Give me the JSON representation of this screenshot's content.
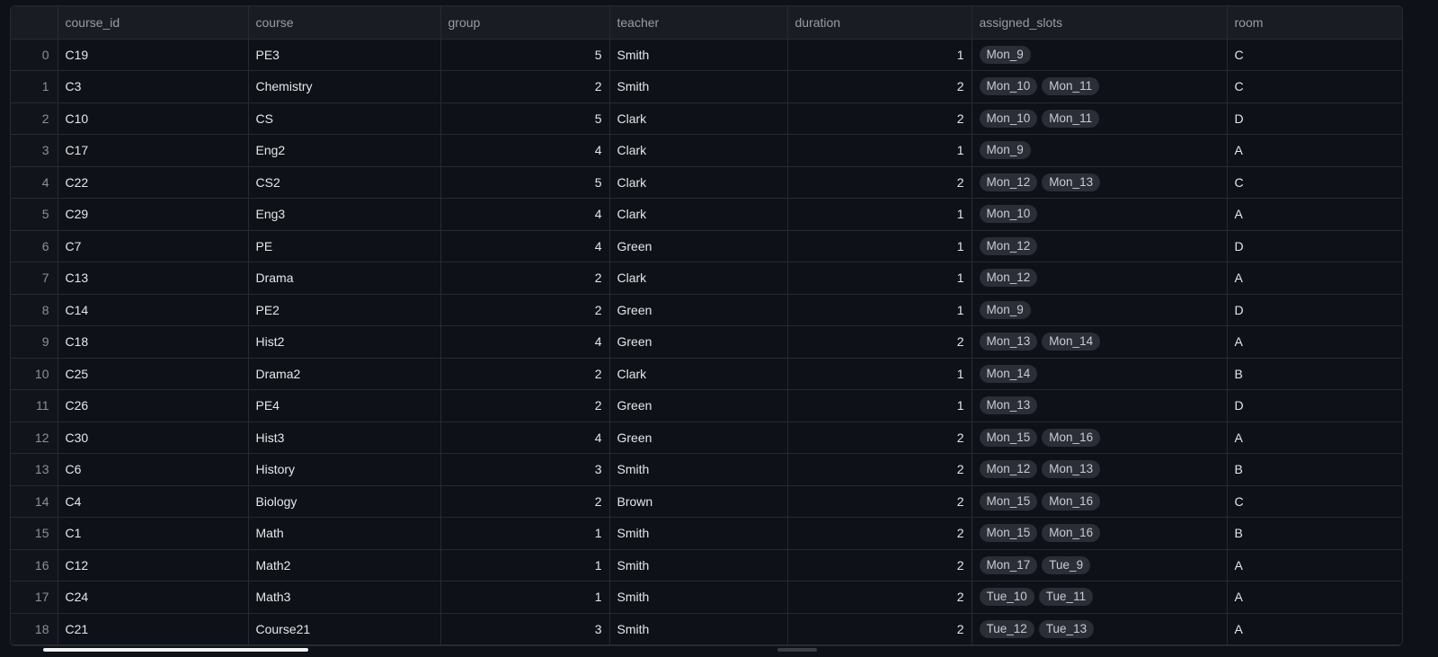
{
  "columns": [
    "",
    "course_id",
    "course",
    "group",
    "teacher",
    "duration",
    "assigned_slots",
    "room"
  ],
  "rows": [
    {
      "idx": "0",
      "course_id": "C19",
      "course": "PE3",
      "group": "5",
      "teacher": "Smith",
      "duration": "1",
      "slots": [
        "Mon_9"
      ],
      "room": "C"
    },
    {
      "idx": "1",
      "course_id": "C3",
      "course": "Chemistry",
      "group": "2",
      "teacher": "Smith",
      "duration": "2",
      "slots": [
        "Mon_10",
        "Mon_11"
      ],
      "room": "C"
    },
    {
      "idx": "2",
      "course_id": "C10",
      "course": "CS",
      "group": "5",
      "teacher": "Clark",
      "duration": "2",
      "slots": [
        "Mon_10",
        "Mon_11"
      ],
      "room": "D"
    },
    {
      "idx": "3",
      "course_id": "C17",
      "course": "Eng2",
      "group": "4",
      "teacher": "Clark",
      "duration": "1",
      "slots": [
        "Mon_9"
      ],
      "room": "A"
    },
    {
      "idx": "4",
      "course_id": "C22",
      "course": "CS2",
      "group": "5",
      "teacher": "Clark",
      "duration": "2",
      "slots": [
        "Mon_12",
        "Mon_13"
      ],
      "room": "C"
    },
    {
      "idx": "5",
      "course_id": "C29",
      "course": "Eng3",
      "group": "4",
      "teacher": "Clark",
      "duration": "1",
      "slots": [
        "Mon_10"
      ],
      "room": "A"
    },
    {
      "idx": "6",
      "course_id": "C7",
      "course": "PE",
      "group": "4",
      "teacher": "Green",
      "duration": "1",
      "slots": [
        "Mon_12"
      ],
      "room": "D"
    },
    {
      "idx": "7",
      "course_id": "C13",
      "course": "Drama",
      "group": "2",
      "teacher": "Clark",
      "duration": "1",
      "slots": [
        "Mon_12"
      ],
      "room": "A"
    },
    {
      "idx": "8",
      "course_id": "C14",
      "course": "PE2",
      "group": "2",
      "teacher": "Green",
      "duration": "1",
      "slots": [
        "Mon_9"
      ],
      "room": "D"
    },
    {
      "idx": "9",
      "course_id": "C18",
      "course": "Hist2",
      "group": "4",
      "teacher": "Green",
      "duration": "2",
      "slots": [
        "Mon_13",
        "Mon_14"
      ],
      "room": "A"
    },
    {
      "idx": "10",
      "course_id": "C25",
      "course": "Drama2",
      "group": "2",
      "teacher": "Clark",
      "duration": "1",
      "slots": [
        "Mon_14"
      ],
      "room": "B"
    },
    {
      "idx": "11",
      "course_id": "C26",
      "course": "PE4",
      "group": "2",
      "teacher": "Green",
      "duration": "1",
      "slots": [
        "Mon_13"
      ],
      "room": "D"
    },
    {
      "idx": "12",
      "course_id": "C30",
      "course": "Hist3",
      "group": "4",
      "teacher": "Green",
      "duration": "2",
      "slots": [
        "Mon_15",
        "Mon_16"
      ],
      "room": "A"
    },
    {
      "idx": "13",
      "course_id": "C6",
      "course": "History",
      "group": "3",
      "teacher": "Smith",
      "duration": "2",
      "slots": [
        "Mon_12",
        "Mon_13"
      ],
      "room": "B"
    },
    {
      "idx": "14",
      "course_id": "C4",
      "course": "Biology",
      "group": "2",
      "teacher": "Brown",
      "duration": "2",
      "slots": [
        "Mon_15",
        "Mon_16"
      ],
      "room": "C"
    },
    {
      "idx": "15",
      "course_id": "C1",
      "course": "Math",
      "group": "1",
      "teacher": "Smith",
      "duration": "2",
      "slots": [
        "Mon_15",
        "Mon_16"
      ],
      "room": "B"
    },
    {
      "idx": "16",
      "course_id": "C12",
      "course": "Math2",
      "group": "1",
      "teacher": "Smith",
      "duration": "2",
      "slots": [
        "Mon_17",
        "Tue_9"
      ],
      "room": "A"
    },
    {
      "idx": "17",
      "course_id": "C24",
      "course": "Math3",
      "group": "1",
      "teacher": "Smith",
      "duration": "2",
      "slots": [
        "Tue_10",
        "Tue_11"
      ],
      "room": "A"
    },
    {
      "idx": "18",
      "course_id": "C21",
      "course": "Course21",
      "group": "3",
      "teacher": "Smith",
      "duration": "2",
      "slots": [
        "Tue_12",
        "Tue_13"
      ],
      "room": "A"
    }
  ]
}
